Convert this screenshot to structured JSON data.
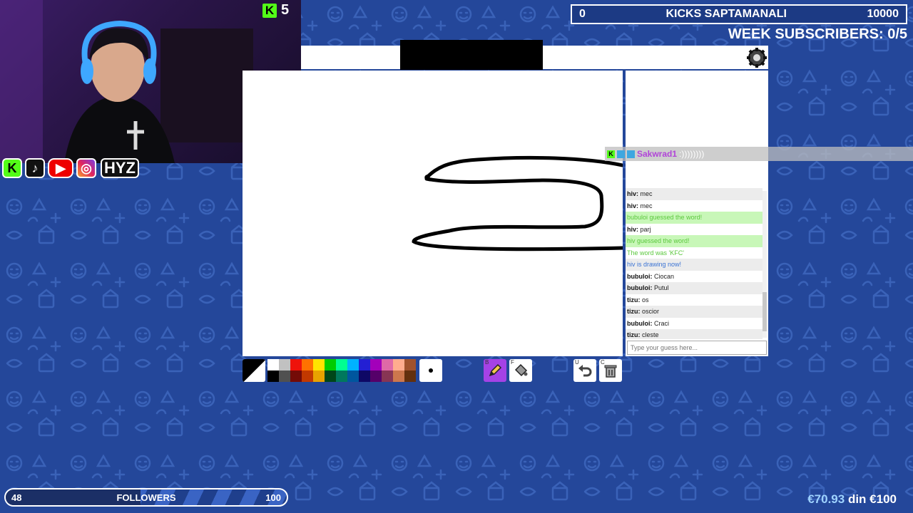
{
  "webcam": {
    "kick_count": "5"
  },
  "socials": {
    "handle": "HYZ"
  },
  "goal": {
    "left_value": "0",
    "title": "KICKS SAPTAMANALI",
    "right_value": "10000"
  },
  "week_subscribers": "WEEK SUBSCRIBERS: 0/5",
  "overlay_chat": {
    "user": "Sakwrad1",
    "text": ":))))))))"
  },
  "chat": {
    "messages": [
      {
        "user": "hiv:",
        "text": "mec",
        "style": "alt"
      },
      {
        "user": "hiv:",
        "text": "mec",
        "style": "plain"
      },
      {
        "user": "",
        "text": "bubuloi guessed the word!",
        "style": "green"
      },
      {
        "user": "hiv:",
        "text": "parj",
        "style": "plain"
      },
      {
        "user": "",
        "text": "hiv guessed the word!",
        "style": "green"
      },
      {
        "user": "",
        "text": "The word was 'KFC'",
        "style": "greentext"
      },
      {
        "user": "",
        "text": "hiv is drawing now!",
        "style": "blue"
      },
      {
        "user": "bubuloi:",
        "text": "Ciocan",
        "style": "plain"
      },
      {
        "user": "bubuloi:",
        "text": "Putul",
        "style": "alt"
      },
      {
        "user": "tizu:",
        "text": "os",
        "style": "plain"
      },
      {
        "user": "tizu:",
        "text": "oscior",
        "style": "alt"
      },
      {
        "user": "bubuloi:",
        "text": "Craci",
        "style": "plain"
      },
      {
        "user": "tizu:",
        "text": "cleste",
        "style": "alt"
      }
    ],
    "guess_placeholder": "Type your guess here..."
  },
  "palette": {
    "top": [
      "#ffffff",
      "#c1c1c1",
      "#ef130b",
      "#ff7100",
      "#ffe400",
      "#00cc00",
      "#00ff91",
      "#00b2ff",
      "#231fd3",
      "#a300ba",
      "#df69a7",
      "#ffac8e",
      "#a0522d"
    ],
    "bottom": [
      "#000000",
      "#505050",
      "#740b07",
      "#c23800",
      "#e8a200",
      "#004619",
      "#00785d",
      "#00569e",
      "#0e0865",
      "#550069",
      "#873554",
      "#cc774d",
      "#63300d"
    ]
  },
  "tools": {
    "brush_key": "B",
    "fill_key": "F",
    "undo_key": "U",
    "clear_key": "C"
  },
  "followers": {
    "current": "48",
    "label": "FOLLOWERS",
    "goal": "100",
    "progress": 0.48
  },
  "donation": {
    "amount": "€70.93",
    "suffix": "din €100"
  }
}
